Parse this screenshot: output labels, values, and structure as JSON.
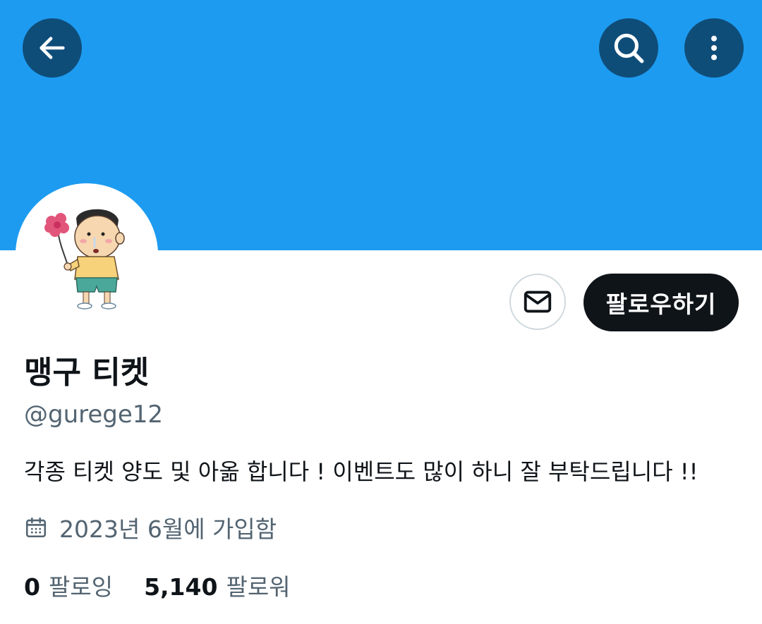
{
  "header": {
    "back_icon": "arrow-left-icon",
    "search_icon": "search-icon",
    "more_icon": "more-vertical-icon",
    "banner_color": "#1d9bf0",
    "button_color": "#0f4d79"
  },
  "profile": {
    "display_name": "맹구 티켓",
    "handle": "@gurege12",
    "bio": "각종 티켓 양도 및 아옮 합니다 ! 이벤트도 많이 하니 잘 부탁드립니다 !!",
    "joined": "2023년 6월에 가입함",
    "following_count": "0",
    "following_label": "팔로잉",
    "followers_count": "5,140",
    "followers_label": "팔로워"
  },
  "actions": {
    "message_icon": "mail-icon",
    "follow_label": "팔로우하기"
  }
}
